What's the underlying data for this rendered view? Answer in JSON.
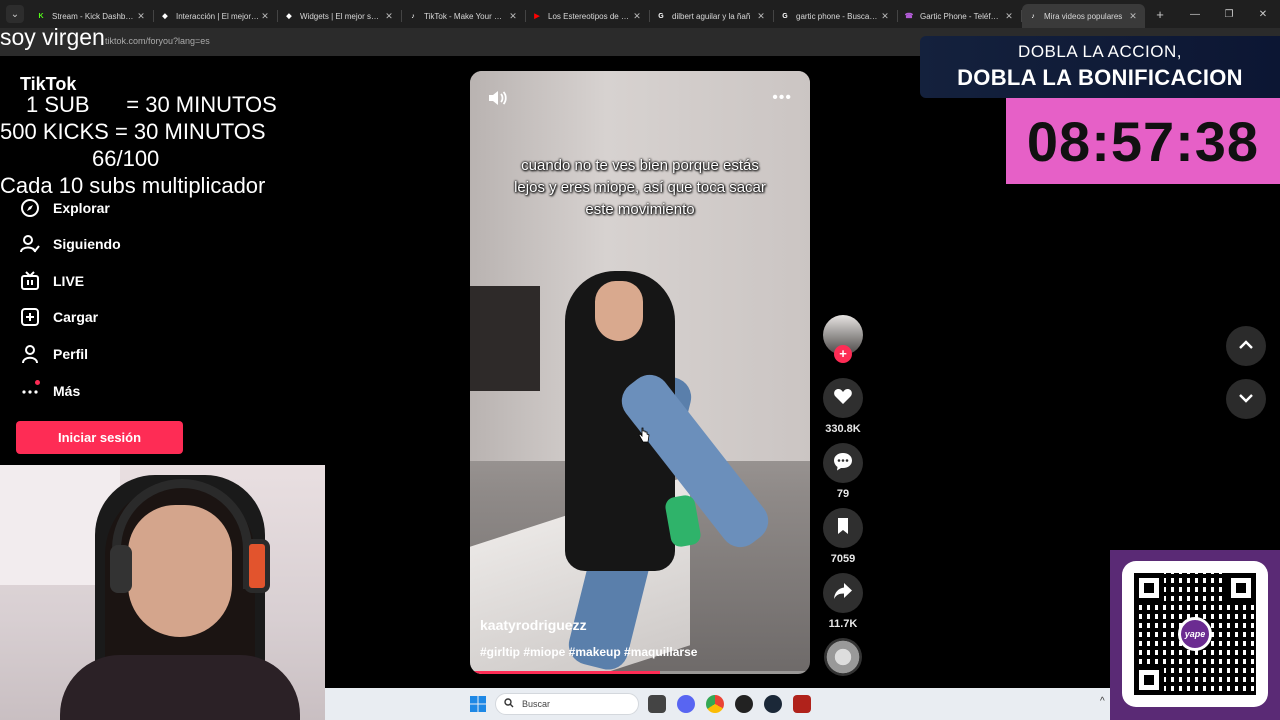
{
  "browser": {
    "tabs": [
      {
        "title": "Stream - Kick Dashboard",
        "favicon": "kick-icon",
        "color": "#53fc18",
        "glyph": "K",
        "active": false
      },
      {
        "title": "Interacción | El mejor so",
        "favicon": "diamond-icon",
        "color": "#ffffff",
        "glyph": "◆",
        "active": false
      },
      {
        "title": "Widgets | El mejor softwa",
        "favicon": "diamond-icon",
        "color": "#ffffff",
        "glyph": "◆",
        "active": false
      },
      {
        "title": "TikTok - Make Your Day",
        "favicon": "tiktok-icon",
        "color": "#ffffff",
        "glyph": "♪",
        "active": false
      },
      {
        "title": "Los Estereotipos de MUJ",
        "favicon": "youtube-icon",
        "color": "#ff0000",
        "glyph": "▶",
        "active": false
      },
      {
        "title": "dilbert aguilar y la ñañ",
        "favicon": "google-icon",
        "color": "#ffffff",
        "glyph": "G",
        "active": false
      },
      {
        "title": "gartic phone - Buscar co",
        "favicon": "google-icon",
        "color": "#ffffff",
        "glyph": "G",
        "active": false
      },
      {
        "title": "Gartic Phone - Teléfono",
        "favicon": "gartic-icon",
        "color": "#b25bd6",
        "glyph": "☎",
        "active": false
      },
      {
        "title": "Mira videos populares",
        "favicon": "tiktok-icon",
        "color": "#ffffff",
        "glyph": "♪",
        "active": true
      }
    ],
    "url": "tiktok.com/foryou?lang=es"
  },
  "overlay": {
    "top_text": "soy virgen",
    "line1": "1 SUB      = 30 MINUTOS",
    "line2": "500 KICKS = 30 MINUTOS",
    "line3": "66/100",
    "line4": "Cada 10 subs multiplicador",
    "tiktok_logo": "TikTok"
  },
  "sidebar": {
    "items": [
      {
        "label": "Explorar",
        "icon": "compass-icon"
      },
      {
        "label": "Siguiendo",
        "icon": "following-icon"
      },
      {
        "label": "LIVE",
        "icon": "live-tv-icon"
      },
      {
        "label": "Cargar",
        "icon": "upload-plus-icon"
      },
      {
        "label": "Perfil",
        "icon": "profile-icon"
      },
      {
        "label": "Más",
        "icon": "more-dots-icon"
      }
    ],
    "login_label": "Iniciar sesión"
  },
  "video": {
    "caption": "cuando no te ves bien porque estás lejos y eres miope, así que toca sacar este movimiento",
    "author": "kaatyrodriguezz",
    "tags": "#girltip #miope #makeup #maquillarse",
    "progress": 0.56
  },
  "actions": {
    "likes": "330.8K",
    "comments": "79",
    "saves": "7059",
    "shares": "11.7K"
  },
  "stream_overlay": {
    "banner_line1": "DOBLA LA ACCION,",
    "banner_line2": "DOBLA LA BONIFICACION",
    "timer": "08:57:38",
    "qr_brand": "yape"
  },
  "taskbar": {
    "search_placeholder": "Buscar"
  },
  "colors": {
    "accent": "#fe2c55",
    "timer_bg": "#e660c7",
    "qr_frame": "#5a2a75"
  }
}
